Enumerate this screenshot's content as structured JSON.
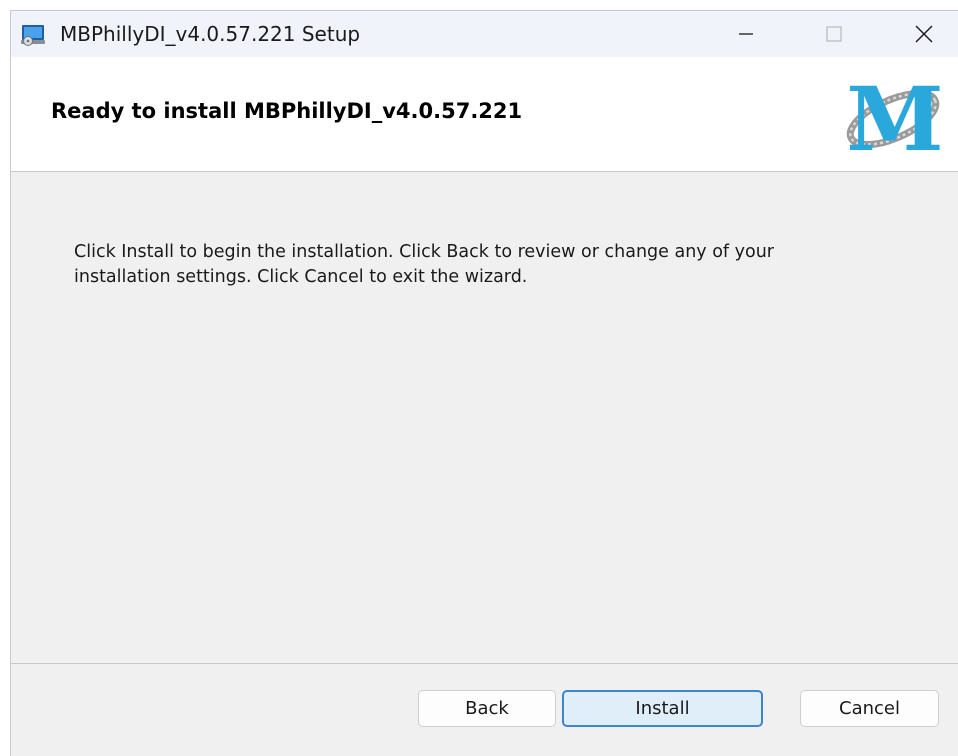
{
  "window": {
    "title": "MBPhillyDI_v4.0.57.221 Setup"
  },
  "banner": {
    "title": "Ready to install MBPhillyDI_v4.0.57.221",
    "logo_letter": "M"
  },
  "body": {
    "instructions_line1": "Click Install to begin the installation. Click Back to review or change any of your",
    "instructions_line2": "installation settings. Click Cancel to exit the wizard."
  },
  "buttons": {
    "back": "Back",
    "install": "Install",
    "cancel": "Cancel"
  },
  "colors": {
    "accent": "#3c86cc",
    "logo_blue": "#2aa8dc"
  }
}
